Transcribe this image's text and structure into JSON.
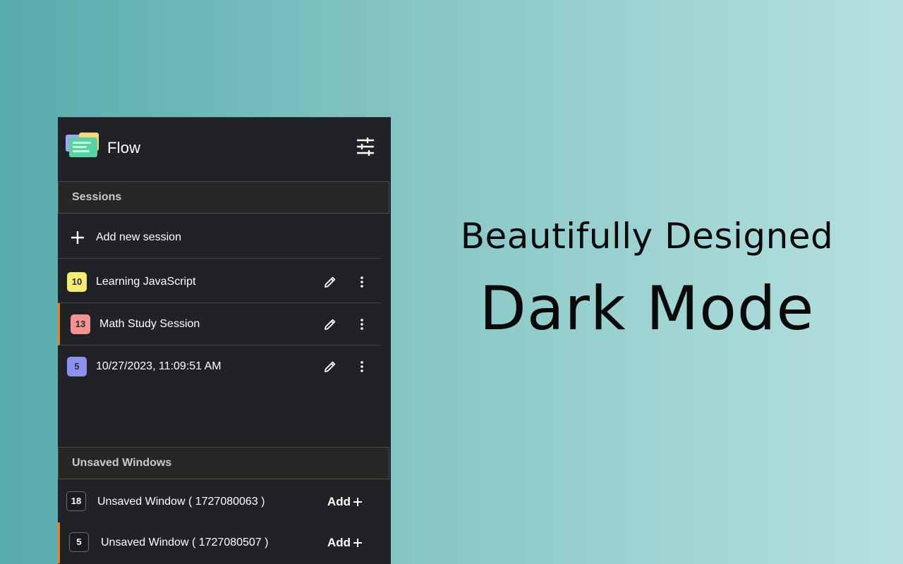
{
  "app": {
    "title": "Flow"
  },
  "icons": {
    "logo": "flow-logo-icon",
    "settings": "sliders-icon",
    "add": "plus-icon",
    "edit": "pencil-icon",
    "more": "more-vertical-icon"
  },
  "sessions": {
    "header": "Sessions",
    "add_label": "Add new session",
    "items": [
      {
        "count": "10",
        "label": "Learning JavaScript",
        "color": "#f4ec74",
        "active": false
      },
      {
        "count": "13",
        "label": "Math Study Session",
        "color": "#f39393",
        "active": true
      },
      {
        "count": "5",
        "label": "10/27/2023, 11:09:51 AM",
        "color": "#8b93ee",
        "active": false
      }
    ]
  },
  "unsaved": {
    "header": "Unsaved Windows",
    "add_label": "Add",
    "items": [
      {
        "count": "18",
        "label": "Unsaved Window ( 1727080063 )",
        "active": false
      },
      {
        "count": "5",
        "label": "Unsaved Window ( 1727080507 )",
        "active": true
      }
    ]
  },
  "promo": {
    "subtitle": "Beautifully Designed",
    "title": "Dark Mode"
  },
  "colors": {
    "accent": "#f07f19",
    "panel": "#212226",
    "section_header": "#262724"
  }
}
